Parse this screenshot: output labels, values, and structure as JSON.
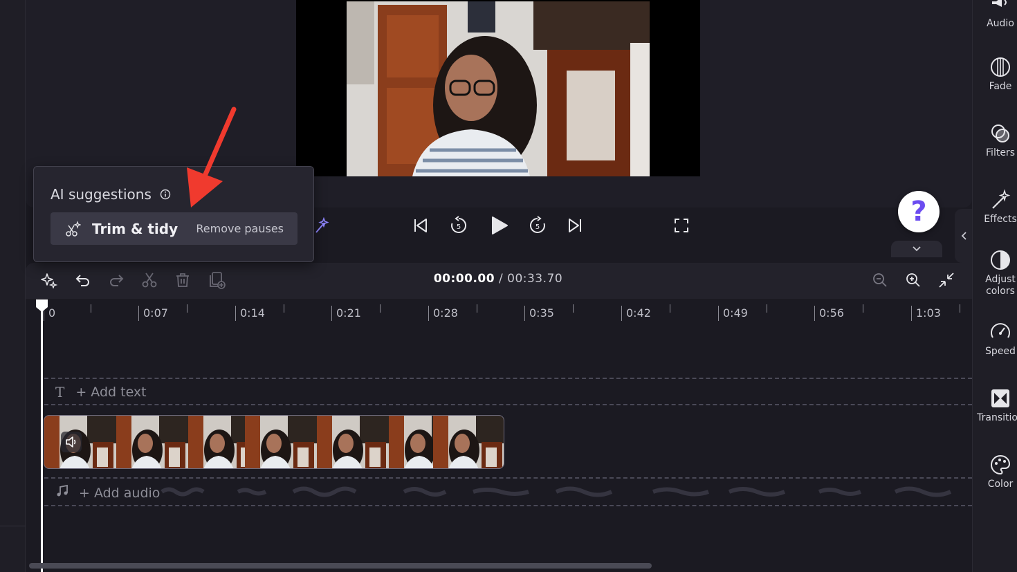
{
  "right_panel": {
    "items": [
      {
        "label": "Audio",
        "icon": "audio-icon"
      },
      {
        "label": "Fade",
        "icon": "fade-icon"
      },
      {
        "label": "Filters",
        "icon": "filters-icon"
      },
      {
        "label": "Effects",
        "icon": "effects-icon"
      },
      {
        "label": "Adjust colors",
        "icon": "adjust-colors-icon"
      },
      {
        "label": "Speed",
        "icon": "speed-icon"
      },
      {
        "label": "Transition",
        "icon": "transition-icon"
      },
      {
        "label": "Color",
        "icon": "color-icon"
      }
    ]
  },
  "playback": {
    "skip_back": "skip-to-start-icon",
    "rewind_5": "5",
    "play": "play-icon",
    "forward_5": "5",
    "skip_forward": "skip-to-end-icon",
    "fullscreen": "fullscreen-icon"
  },
  "help": {
    "symbol": "?"
  },
  "timeline": {
    "current_time": "00:00.00",
    "separator": " / ",
    "total_time": "00:33.70",
    "ruler_labels": [
      "0",
      "0:07",
      "0:14",
      "0:21",
      "0:28",
      "0:35",
      "0:42",
      "0:49",
      "0:56",
      "1:03"
    ],
    "add_text": "+ Add text",
    "add_audio": "+ Add audio"
  },
  "ai_popup": {
    "title": "AI suggestions",
    "button_label": "Trim & tidy",
    "button_sub": "Remove pauses"
  },
  "colors": {
    "accent": "#7b5cff",
    "annotation_arrow": "#f03a2e",
    "background": "#1b1a22"
  }
}
